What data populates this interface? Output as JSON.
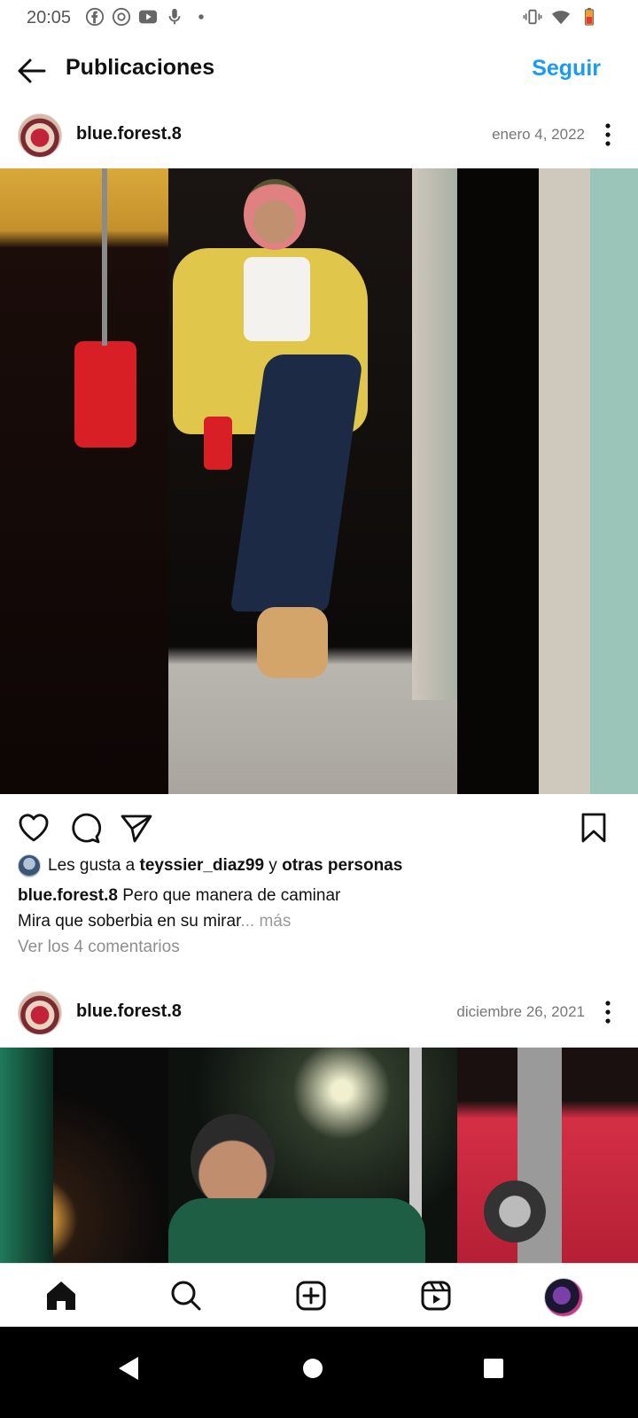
{
  "status_bar": {
    "time": "20:05",
    "left_icons": [
      "facebook-icon",
      "chrome-icon",
      "youtube-icon",
      "mic-icon",
      "dot-icon"
    ],
    "right_icons": [
      "vibrate-icon",
      "wifi-icon",
      "battery-icon"
    ]
  },
  "header": {
    "title": "Publicaciones",
    "follow_label": "Seguir"
  },
  "posts": [
    {
      "username": "blue.forest.8",
      "date": "enero 4, 2022",
      "likes": {
        "prefix": "Les gusta a ",
        "liker": "teyssier_diaz99",
        "conjunction": " y ",
        "others": "otras personas"
      },
      "caption": {
        "author": "blue.forest.8",
        "line1": " Pero que manera de caminar",
        "line2": "Mira que soberbia en su mirar",
        "ellipsis": "...",
        "more": " más"
      },
      "comments_link": "Ver los 4 comentarios"
    },
    {
      "username": "blue.forest.8",
      "date": "diciembre 26, 2021"
    }
  ],
  "bottom_nav": [
    "home-icon",
    "search-icon",
    "create-icon",
    "reels-icon",
    "profile-avatar"
  ],
  "system_nav": [
    "back-icon",
    "home-circle-icon",
    "recents-icon"
  ],
  "colors": {
    "accent": "#1a9bf0",
    "muted": "#8e8e8e"
  }
}
